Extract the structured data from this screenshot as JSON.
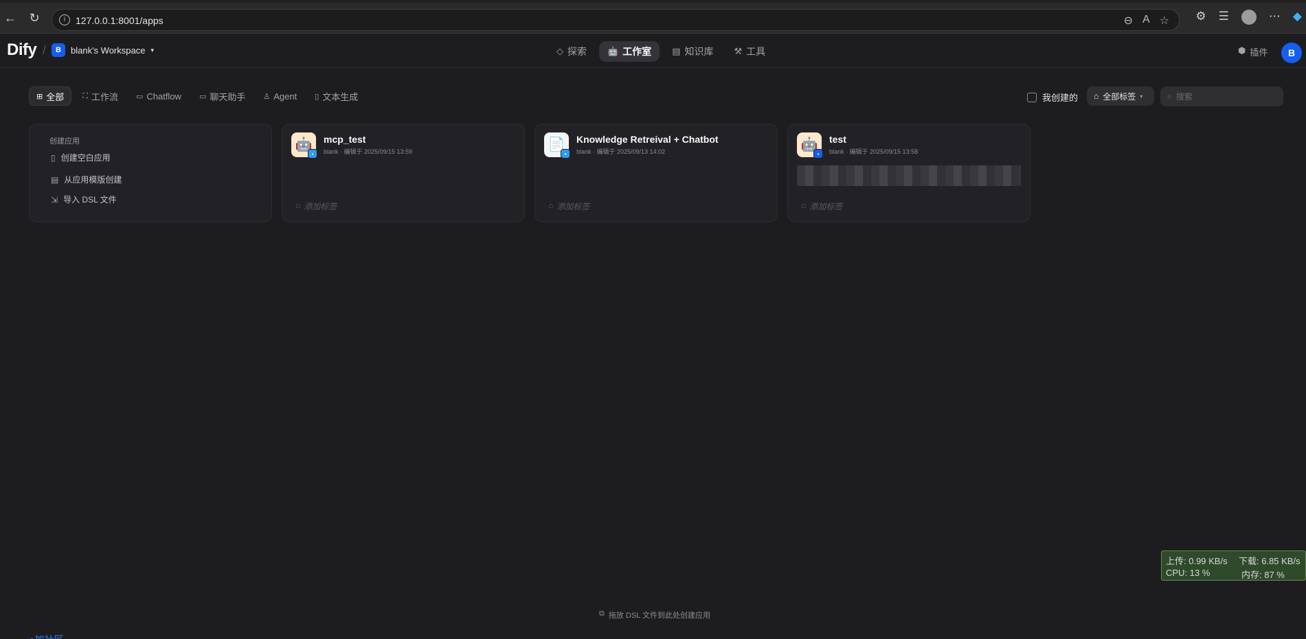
{
  "browser": {
    "url": "127.0.0.1:8001/apps"
  },
  "header": {
    "logo": "Dify",
    "workspace_initial": "B",
    "workspace_name": "blank's Workspace",
    "nav": [
      {
        "label": "探索",
        "icon": "compass-icon"
      },
      {
        "label": "工作室",
        "icon": "robot-icon"
      },
      {
        "label": "知识库",
        "icon": "book-icon"
      },
      {
        "label": "工具",
        "icon": "hammer-icon"
      }
    ],
    "plugins_label": "插件",
    "user_initial": "B"
  },
  "filters": {
    "tabs": [
      {
        "label": "全部"
      },
      {
        "label": "工作流"
      },
      {
        "label": "Chatflow"
      },
      {
        "label": "聊天助手"
      },
      {
        "label": "Agent"
      },
      {
        "label": "文本生成"
      }
    ],
    "mine_label": "我创建的",
    "tags_label": "全部标签",
    "search_placeholder": "搜索"
  },
  "create_card": {
    "title": "创建应用",
    "items": [
      {
        "label": "创建空白应用"
      },
      {
        "label": "从应用模版创建"
      },
      {
        "label": "导入 DSL 文件"
      }
    ]
  },
  "apps": [
    {
      "name": "mcp_test",
      "meta": "blank · 编辑于 2025/09/15 13:59",
      "tag_placeholder": "添加标签"
    },
    {
      "name": "Knowledge Retreival + Chatbot",
      "meta": "blank · 编辑于 2025/09/13 14:02",
      "tag_placeholder": "添加标签"
    },
    {
      "name": "test",
      "meta": "blank · 编辑于 2025/09/15 13:58",
      "tag_placeholder": "添加标签"
    }
  ],
  "footer": {
    "drop_hint": "拖放 DSL 文件到此处创建应用",
    "community": "●加社区"
  },
  "netmon": {
    "upload": "上传: 0.99 KB/s",
    "download": "下载: 6.85 KB/s",
    "cpu": "CPU: 13 %",
    "memory": "内存: 87 %"
  }
}
